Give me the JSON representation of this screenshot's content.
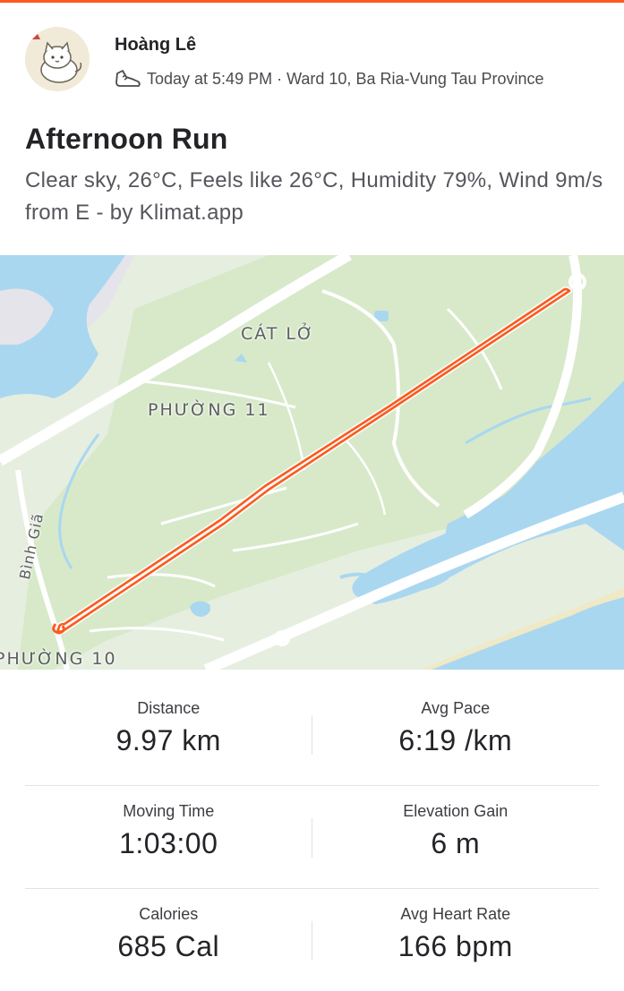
{
  "athlete": {
    "name": "Hoàng Lê",
    "avatar_icon": "cat-avatar-icon"
  },
  "meta": {
    "sport_icon": "shoe-icon",
    "text": "Today at 5:49 PM · Ward 10, Ba Ria-Vung Tau Province"
  },
  "activity": {
    "title": "Afternoon Run",
    "description": "Clear sky, 26°C, Feels like 26°C, Humidity 79%, Wind 9m/s from E - by Klimat.app"
  },
  "map": {
    "labels": {
      "cat_lo": "CÁT LỞ",
      "phuong_11": "PHƯỜNG 11",
      "phuong_10": "PHƯỜNG 10",
      "street": "Bình Giã"
    },
    "route_color": "#fc5a1f"
  },
  "stats": [
    [
      {
        "label": "Distance",
        "value": "9.97 km"
      },
      {
        "label": "Avg Pace",
        "value": "6:19 /km"
      }
    ],
    [
      {
        "label": "Moving Time",
        "value": "1:03:00"
      },
      {
        "label": "Elevation Gain",
        "value": "6 m"
      }
    ],
    [
      {
        "label": "Calories",
        "value": "685 Cal"
      },
      {
        "label": "Avg Heart Rate",
        "value": "166 bpm"
      }
    ]
  ],
  "colors": {
    "accent": "#fc5a1f",
    "water": "#a9d8f2",
    "park": "#d4e9c9"
  }
}
